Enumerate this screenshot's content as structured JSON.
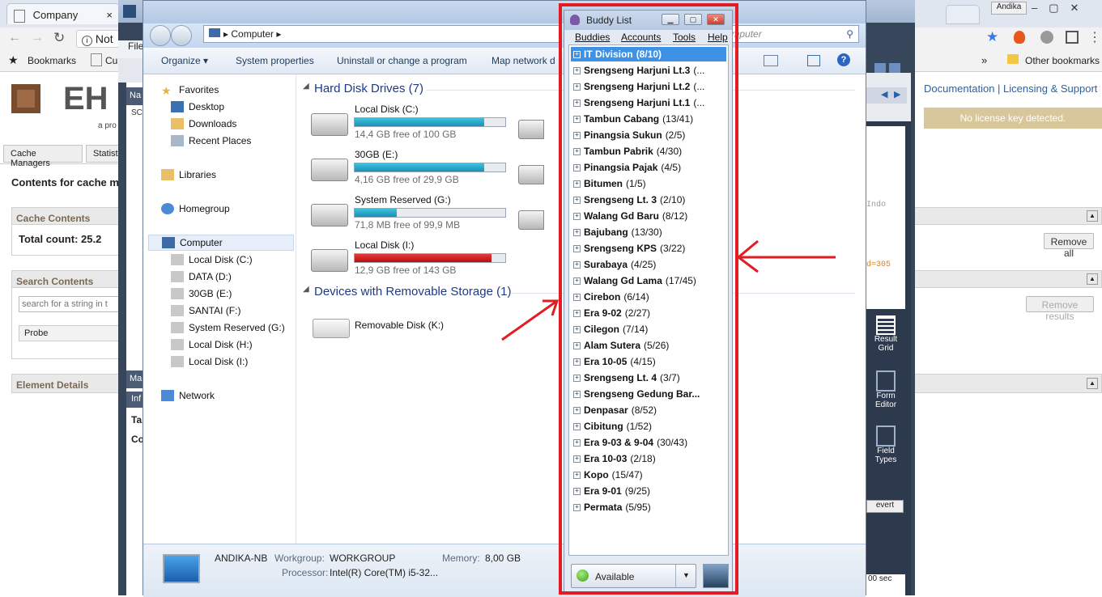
{
  "browser": {
    "tabs": [
      "Company"
    ],
    "address_prefix": "Not",
    "bookmarks_bar": {
      "bookmarks_label": "Bookmarks",
      "item2": "Cu",
      "other_bookmarks": "Other bookmarks"
    },
    "profile_name": "Andika"
  },
  "web_page": {
    "logo_text": "EH",
    "logo_sub": "a pro",
    "header_links": "Documentation | Licensing & Support",
    "license_notice": "No license key detected.",
    "tabs": [
      "Cache Managers",
      "Statist"
    ],
    "contents_title": "Contents for cache m",
    "cache_contents": {
      "title": "Cache Contents",
      "total_label": "Total count: 25.2",
      "remove_all": "Remove all"
    },
    "search_contents": {
      "title": "Search Contents",
      "placeholder": "search for a string in t",
      "remove_results": "Remove results",
      "probe_col": "Probe"
    },
    "element_details": {
      "title": "Element Details"
    }
  },
  "ide": {
    "left_labels": [
      "Na",
      "SC",
      "Ma",
      "Inf",
      "Ta",
      "Co"
    ],
    "file_menu": "File",
    "right_tools": [
      {
        "label": "Result Grid"
      },
      {
        "label": "Form Editor"
      },
      {
        "label": "Field Types"
      }
    ],
    "revert": "evert",
    "timing": "00 sec",
    "code_frag1": "Indo",
    "code_frag2": "d=305"
  },
  "explorer": {
    "breadcrumb": "Computer",
    "search_placeholder": "h Computer",
    "commands": [
      "Organize",
      "System properties",
      "Uninstall or change a program",
      "Map network d"
    ],
    "nav": {
      "favorites": "Favorites",
      "favorites_items": [
        "Desktop",
        "Downloads",
        "Recent Places"
      ],
      "libraries": "Libraries",
      "homegroup": "Homegroup",
      "computer": "Computer",
      "computer_items": [
        "Local Disk (C:)",
        "DATA (D:)",
        "30GB (E:)",
        "SANTAI (F:)",
        "System Reserved (G:)",
        "Local Disk (H:)",
        "Local Disk (I:)"
      ],
      "network": "Network"
    },
    "hard_disk_title": "Hard Disk Drives (7)",
    "drives": [
      {
        "name": "Local Disk (C:)",
        "free": "14,4 GB free of 100 GB",
        "used_pct": 86,
        "color": "blue"
      },
      {
        "name": "30GB (E:)",
        "free": "4,16 GB free of 29,9 GB",
        "used_pct": 86,
        "color": "blue"
      },
      {
        "name": "System Reserved (G:)",
        "free": "71,8 MB free of 99,9 MB",
        "used_pct": 28,
        "color": "blue"
      },
      {
        "name": "Local Disk (I:)",
        "free": "12,9 GB free of 143 GB",
        "used_pct": 91,
        "color": "red"
      }
    ],
    "removable_title": "Devices with Removable Storage (1)",
    "removable": {
      "name": "Removable Disk (K:)"
    },
    "status": {
      "computer_name": "ANDIKA-NB",
      "workgroup_label": "Workgroup:",
      "workgroup": "WORKGROUP",
      "memory_label": "Memory:",
      "memory": "8,00 GB",
      "processor_label": "Processor:",
      "processor": "Intel(R) Core(TM) i5-32..."
    }
  },
  "buddy_list": {
    "title": "Buddy List",
    "menu": [
      "Buddies",
      "Accounts",
      "Tools",
      "Help"
    ],
    "groups": [
      {
        "name": "IT Division",
        "count": "(8/10)"
      },
      {
        "name": "Srengseng Harjuni Lt.3",
        "count": "(..."
      },
      {
        "name": "Srengseng Harjuni Lt.2",
        "count": "(..."
      },
      {
        "name": "Srengseng Harjuni Lt.1",
        "count": "(..."
      },
      {
        "name": "Tambun Cabang",
        "count": "(13/41)"
      },
      {
        "name": "Pinangsia Sukun",
        "count": "(2/5)"
      },
      {
        "name": "Tambun Pabrik",
        "count": "(4/30)"
      },
      {
        "name": "Pinangsia Pajak",
        "count": "(4/5)"
      },
      {
        "name": "Bitumen",
        "count": "(1/5)"
      },
      {
        "name": "Srengseng Lt. 3",
        "count": "(2/10)"
      },
      {
        "name": "Walang Gd Baru",
        "count": "(8/12)"
      },
      {
        "name": "Bajubang",
        "count": "(13/30)"
      },
      {
        "name": "Srengseng KPS",
        "count": "(3/22)"
      },
      {
        "name": "Surabaya",
        "count": "(4/25)"
      },
      {
        "name": "Walang Gd Lama",
        "count": "(17/45)"
      },
      {
        "name": "Cirebon",
        "count": "(6/14)"
      },
      {
        "name": "Era 9-02",
        "count": "(2/27)"
      },
      {
        "name": "Cilegon",
        "count": "(7/14)"
      },
      {
        "name": "Alam Sutera",
        "count": "(5/26)"
      },
      {
        "name": "Era 10-05",
        "count": "(4/15)"
      },
      {
        "name": "Srengseng Lt. 4",
        "count": "(3/7)"
      },
      {
        "name": "Srengseng Gedung Bar...",
        "count": ""
      },
      {
        "name": "Denpasar",
        "count": "(8/52)"
      },
      {
        "name": "Cibitung",
        "count": "(1/52)"
      },
      {
        "name": " Era 9-03 & 9-04",
        "count": " (30/43)"
      },
      {
        "name": "Era 10-03",
        "count": "(2/18)"
      },
      {
        "name": "Kopo",
        "count": "(15/47)"
      },
      {
        "name": "Era 9-01",
        "count": "(9/25)"
      },
      {
        "name": "Permata",
        "count": "(5/95)"
      }
    ],
    "status": "Available"
  },
  "colors": {
    "highlight": "#e31b23",
    "selection": "#3e92e6",
    "license_bg": "#d8c79a"
  }
}
